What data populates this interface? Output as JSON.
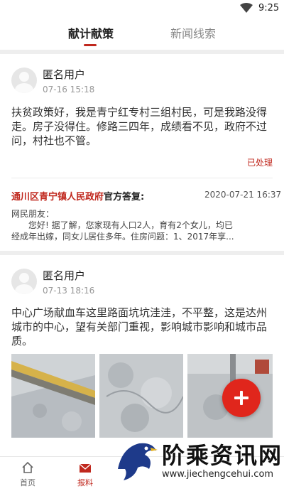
{
  "statusbar": {
    "time": "9:25"
  },
  "tabs": [
    {
      "label": "献计献策"
    },
    {
      "label": "新闻线索"
    }
  ],
  "posts": [
    {
      "username": "匿名用户",
      "time": "07-16  15:18",
      "text": "扶贫政策好，我是青宁红专村三组村民，可是我路没得走。房子没得住。修路三四年，成绩看不见，政府不过问，村社也不管。",
      "status": "已处理",
      "reply": {
        "org": "通川区青宁镇人民政府",
        "suffix": "官方答复:",
        "date": "2020-07-21 16:37",
        "lines": [
          "网民朋友：",
          "您好! 据了解，您家现有人口2人，育有2个女儿，均已",
          "经成年出嫁，同女儿居住多年。住房问题：1、2017年享..."
        ]
      }
    },
    {
      "username": "匿名用户",
      "time": "07-13  18:16",
      "text": "中心广场献血车这里路面坑坑洼洼，不平整，这是达州城市的中心，望有关部门重视，影响城市影响和城市品质。"
    }
  ],
  "bottomnav": [
    {
      "label": "首页",
      "icon": "home-icon"
    },
    {
      "label": "报料",
      "icon": "mail-icon"
    }
  ],
  "watermark": {
    "text": "阶乘资讯网",
    "url": "www.jiechengcehui.com"
  },
  "colors": {
    "accent": "#c0281e",
    "fab": "#e0261c"
  }
}
